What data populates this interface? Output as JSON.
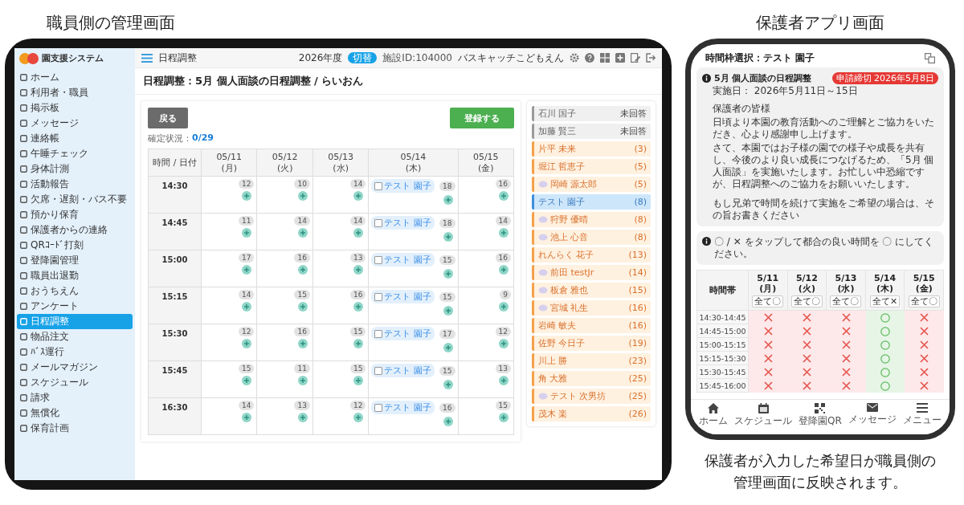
{
  "tablet_caption": "職員側の管理画面",
  "tablet": {
    "logo": "園支援システム",
    "sidebar": {
      "items": [
        {
          "label": "ホーム",
          "selected": false
        },
        {
          "label": "利用者・職員",
          "selected": false
        },
        {
          "label": "掲示板",
          "selected": false
        },
        {
          "label": "メッセージ",
          "selected": false
        },
        {
          "label": "連絡帳",
          "selected": false
        },
        {
          "label": "午睡チェック",
          "selected": false
        },
        {
          "label": "身体計測",
          "selected": false
        },
        {
          "label": "活動報告",
          "selected": false
        },
        {
          "label": "欠席・遅刻・バス不要",
          "selected": false
        },
        {
          "label": "預かり保育",
          "selected": false
        },
        {
          "label": "保護者からの連絡",
          "selected": false
        },
        {
          "label": "QRｺｰﾄﾞ打刻",
          "selected": false
        },
        {
          "label": "登降園管理",
          "selected": false
        },
        {
          "label": "職員出退勤",
          "selected": false
        },
        {
          "label": "おうちえん",
          "selected": false
        },
        {
          "label": "アンケート",
          "selected": false
        },
        {
          "label": "日程調整",
          "selected": true
        },
        {
          "label": "物品注文",
          "selected": false
        },
        {
          "label": "ﾊﾞｽ運行",
          "selected": false
        },
        {
          "label": "メールマガジン",
          "selected": false
        },
        {
          "label": "スケジュール",
          "selected": false
        },
        {
          "label": "請求",
          "selected": false
        },
        {
          "label": "無償化",
          "selected": false
        },
        {
          "label": "保育計画",
          "selected": false
        }
      ]
    },
    "header": {
      "page": "日程調整",
      "year": "2026年度",
      "year_badge": "切替",
      "facility_id": "施設ID:104000",
      "facility": "バスキャッチこどもえん"
    },
    "title": "日程調整：5月 個人面談の日程調整 / らいおん",
    "back_button": "戻る",
    "submit_button": "登録する",
    "status_label": "確定状況：",
    "status_value": "0/29",
    "grid": {
      "corner": "時間 / 日付",
      "days": [
        {
          "date": "05/11",
          "weekday": "(月)"
        },
        {
          "date": "05/12",
          "weekday": "(火)"
        },
        {
          "date": "05/13",
          "weekday": "(水)"
        },
        {
          "date": "05/14",
          "weekday": "(木)"
        },
        {
          "date": "05/15",
          "weekday": "(金)"
        }
      ],
      "rows": [
        {
          "time": "14:30",
          "cells": [
            {
              "count": "12"
            },
            {
              "count": "10"
            },
            {
              "count": "14"
            },
            {
              "count": "18",
              "entries": [
                {
                  "name": "テスト 園子",
                  "checked": false
                }
              ]
            },
            {
              "count": "16"
            }
          ]
        },
        {
          "time": "14:45",
          "cells": [
            {
              "count": "11"
            },
            {
              "count": "14"
            },
            {
              "count": "14"
            },
            {
              "count": "18",
              "entries": [
                {
                  "name": "テスト 園子",
                  "checked": false
                }
              ]
            },
            {
              "count": "14"
            }
          ]
        },
        {
          "time": "15:00",
          "cells": [
            {
              "count": "17"
            },
            {
              "count": "16"
            },
            {
              "count": "13"
            },
            {
              "count": "15",
              "entries": [
                {
                  "name": "テスト 園子",
                  "checked": false
                }
              ]
            },
            {
              "count": "16"
            }
          ]
        },
        {
          "time": "15:15",
          "cells": [
            {
              "count": "14"
            },
            {
              "count": "15"
            },
            {
              "count": "16"
            },
            {
              "count": "15",
              "entries": [
                {
                  "name": "テスト 園子",
                  "checked": false
                }
              ]
            },
            {
              "count": "9"
            }
          ]
        },
        {
          "time": "15:30",
          "cells": [
            {
              "count": "12"
            },
            {
              "count": "16"
            },
            {
              "count": "15"
            },
            {
              "count": "17",
              "entries": [
                {
                  "name": "テスト 園子",
                  "checked": false
                }
              ]
            },
            {
              "count": "12"
            }
          ]
        },
        {
          "time": "15:45",
          "cells": [
            {
              "count": "15"
            },
            {
              "count": "11"
            },
            {
              "count": "15"
            },
            {
              "count": "15",
              "entries": [
                {
                  "name": "テスト 園子",
                  "checked": false
                }
              ]
            },
            {
              "count": "13"
            }
          ]
        },
        {
          "time": "16:30",
          "cells": [
            {
              "count": "14"
            },
            {
              "count": "13"
            },
            {
              "count": "12"
            },
            {
              "count": "16",
              "entries": [
                {
                  "name": "テスト 園子",
                  "checked": false
                }
              ]
            },
            {
              "count": "15"
            }
          ]
        }
      ]
    },
    "roster": [
      {
        "name": "石川 国子",
        "count": "未回答",
        "kind": "unanswered",
        "selected": false,
        "chat": false
      },
      {
        "name": "加藤 賢三",
        "count": "未回答",
        "kind": "unanswered",
        "selected": false,
        "chat": false
      },
      {
        "name": "片平 未来",
        "count": "(3)",
        "kind": "answered",
        "selected": false,
        "chat": false
      },
      {
        "name": "堀江 哲恵子",
        "count": "(5)",
        "kind": "answered",
        "selected": false,
        "chat": false
      },
      {
        "name": "岡崎 源太郎",
        "count": "(5)",
        "kind": "answered",
        "selected": false,
        "chat": true
      },
      {
        "name": "テスト 園子",
        "count": "(8)",
        "kind": "answered",
        "selected": true,
        "chat": false
      },
      {
        "name": "狩野 優晴",
        "count": "(8)",
        "kind": "answered",
        "selected": false,
        "chat": true
      },
      {
        "name": "池上 心音",
        "count": "(8)",
        "kind": "answered",
        "selected": false,
        "chat": true
      },
      {
        "name": "れんらく 花子",
        "count": "(13)",
        "kind": "answered",
        "selected": false,
        "chat": false
      },
      {
        "name": "前田 testJr",
        "count": "(14)",
        "kind": "answered",
        "selected": false,
        "chat": true
      },
      {
        "name": "板倉 雅也",
        "count": "(15)",
        "kind": "answered",
        "selected": false,
        "chat": true
      },
      {
        "name": "宮城 礼生",
        "count": "(16)",
        "kind": "answered",
        "selected": false,
        "chat": true
      },
      {
        "name": "岩崎 敏夫",
        "count": "(16)",
        "kind": "answered",
        "selected": false,
        "chat": false
      },
      {
        "name": "佐野 今日子",
        "count": "(19)",
        "kind": "answered",
        "selected": false,
        "chat": false
      },
      {
        "name": "川上 勝",
        "count": "(23)",
        "kind": "answered",
        "selected": false,
        "chat": false
      },
      {
        "name": "角 大雅",
        "count": "(25)",
        "kind": "answered",
        "selected": false,
        "chat": false
      },
      {
        "name": "テスト 次男坊",
        "count": "(25)",
        "kind": "answered",
        "selected": false,
        "chat": true
      },
      {
        "name": "茂木 楽",
        "count": "(26)",
        "kind": "answered",
        "selected": false,
        "chat": false
      }
    ]
  },
  "phone_caption": "保護者アプリ画面",
  "phone": {
    "title": "時間枠選択：テスト 園子",
    "notice": {
      "title": "5月 個人面談の日程調整",
      "deadline": "申請締切 2026年5月8日",
      "date": "実施日： 2026年5月11日～15日",
      "body": [
        "保護者の皆様",
        "日頃より本園の教育活動へのご理解とご協力をいただき、心より感謝申し上げます。",
        "さて、本園ではお子様の園での様子や成長を共有し、今後のより良い成長につなげるため、「5月 個人面談」を実施いたします。お忙しい中恐縮ですが、日程調整へのご協力をお願いいたします。",
        "もし兄弟で時間を続けて実施をご希望の場合は、その旨お書きください"
      ]
    },
    "hint": "〇 / ✕ をタップして都合の良い時間を 〇 にしてください。",
    "table": {
      "corner": "時間帯",
      "days": [
        {
          "date": "5/11",
          "weekday": "(月)",
          "all_button": "全て〇"
        },
        {
          "date": "5/12",
          "weekday": "(火)",
          "all_button": "全て〇"
        },
        {
          "date": "5/13",
          "weekday": "(水)",
          "all_button": "全て〇"
        },
        {
          "date": "5/14",
          "weekday": "(木)",
          "all_button": "全て✕"
        },
        {
          "date": "5/15",
          "weekday": "(金)",
          "all_button": "全て〇"
        }
      ],
      "rows": [
        {
          "time": "14:30-14:45",
          "slots": [
            {
              "available": false
            },
            {
              "available": false
            },
            {
              "available": false
            },
            {
              "available": true
            },
            {
              "available": false
            }
          ]
        },
        {
          "time": "14:45-15:00",
          "slots": [
            {
              "available": false
            },
            {
              "available": false
            },
            {
              "available": false
            },
            {
              "available": true
            },
            {
              "available": false
            }
          ]
        },
        {
          "time": "15:00-15:15",
          "slots": [
            {
              "available": false
            },
            {
              "available": false
            },
            {
              "available": false
            },
            {
              "available": true
            },
            {
              "available": false
            }
          ]
        },
        {
          "time": "15:15-15:30",
          "slots": [
            {
              "available": false
            },
            {
              "available": false
            },
            {
              "available": false
            },
            {
              "available": true
            },
            {
              "available": false
            }
          ]
        },
        {
          "time": "15:30-15:45",
          "slots": [
            {
              "available": false
            },
            {
              "available": false
            },
            {
              "available": false
            },
            {
              "available": true
            },
            {
              "available": false
            }
          ]
        },
        {
          "time": "15:45-16:00",
          "slots": [
            {
              "available": false
            },
            {
              "available": false
            },
            {
              "available": false
            },
            {
              "available": true
            },
            {
              "available": false
            }
          ]
        }
      ]
    },
    "nav": [
      {
        "label": "ホーム",
        "kind": "home"
      },
      {
        "label": "スケジュール",
        "kind": "calendar"
      },
      {
        "label": "登降園QR",
        "kind": "qr"
      },
      {
        "label": "メッセージ",
        "kind": "mail"
      },
      {
        "label": "メニュー",
        "kind": "menu"
      }
    ]
  },
  "footer_caption": [
    "保護者が入力した希望日が職員側の",
    "管理画面に反映されます。"
  ]
}
